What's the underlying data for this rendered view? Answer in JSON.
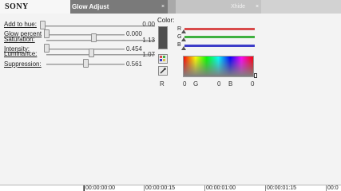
{
  "header": {
    "logo": "SONY",
    "tabs": [
      {
        "label": "Glow Adjust"
      },
      {
        "label": ""
      },
      {
        "label": "Xhide"
      }
    ]
  },
  "controls": {
    "add_to_hue": {
      "label": "Add to hue:",
      "value": "0.00",
      "level": 0.0
    },
    "glow_percent": {
      "label": "Glow percent",
      "value": "0.000",
      "level": 0.0
    },
    "saturation": {
      "label": "Saturation:",
      "value": "1.13",
      "level": 0.57
    },
    "intensity": {
      "label": "Intensity:",
      "value": "0.454",
      "level": 0.02
    },
    "luminance": {
      "label": "Luminance:",
      "value": "1.07",
      "level": 0.52
    },
    "suppression": {
      "label": "Suppression:",
      "value": "0.561",
      "level": 0.48
    }
  },
  "color": {
    "label": "Color:",
    "swatch_hex": "#4e4e4e",
    "channels": [
      {
        "name": "R",
        "color": "#d84a4a"
      },
      {
        "name": "G",
        "color": "#3fb03f"
      },
      {
        "name": "B",
        "color": "#3c3cc8"
      }
    ],
    "readout": {
      "r_label": "R",
      "r_value": "0",
      "g_label": "G",
      "g_value": "0",
      "b_label": "B",
      "b_value": "0"
    }
  },
  "timeline": {
    "ticks": [
      "00:00:00:00",
      "00:00:00:15",
      "00:00:01:00",
      "00:00:01:15",
      "00:0"
    ]
  }
}
